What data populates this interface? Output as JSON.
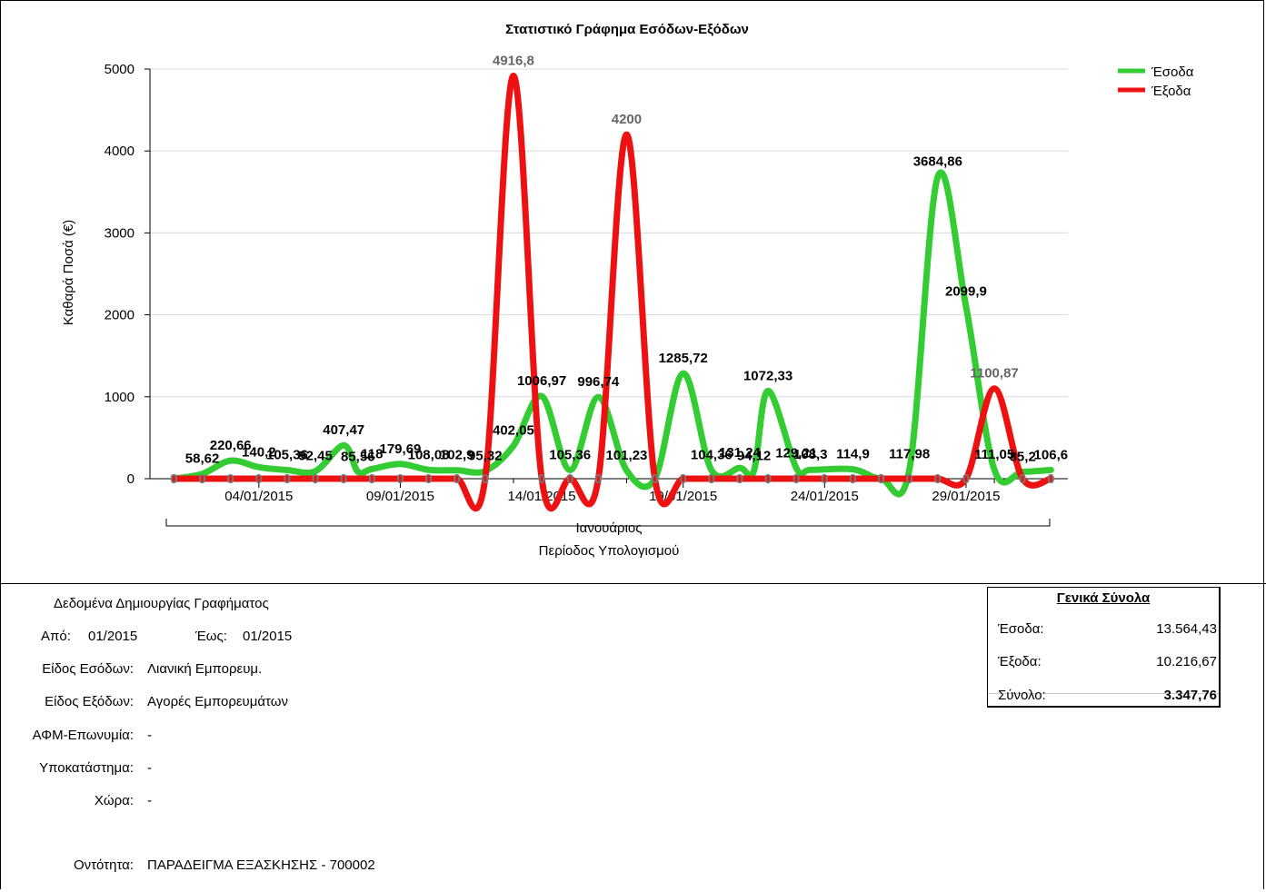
{
  "chart_data": {
    "type": "line",
    "title": "Στατιστικό Γράφημα Εσόδων-Εξόδων",
    "xlabel": "Περίοδος Υπολογισμού",
    "xgroup_label": "Ιανουάριος",
    "ylabel": "Καθαρά Ποσά (€)",
    "ylim": [
      0,
      5000
    ],
    "yticks": [
      "0",
      "1000",
      "2000",
      "3000",
      "4000",
      "5000"
    ],
    "xtick_labels": [
      {
        "day": 4,
        "label": "04/01/2015"
      },
      {
        "day": 9,
        "label": "09/01/2015"
      },
      {
        "day": 14,
        "label": "14/01/2015"
      },
      {
        "day": 19,
        "label": "19/01/2015"
      },
      {
        "day": 24,
        "label": "24/01/2015"
      },
      {
        "day": 29,
        "label": "29/01/2015"
      }
    ],
    "grid": true,
    "legend_position": "top-right",
    "series": [
      {
        "name": "Έσοδα",
        "color": "#33cc33",
        "points": [
          {
            "day": 1,
            "value": 0,
            "label": "0"
          },
          {
            "day": 2,
            "value": 58.62,
            "label": "58,62"
          },
          {
            "day": 3,
            "value": 220.66,
            "label": "220,66"
          },
          {
            "day": 4,
            "value": 140.2,
            "label": "140,2"
          },
          {
            "day": 5,
            "value": 105.36,
            "label": "105,36"
          },
          {
            "day": 6,
            "value": 92.45,
            "label": "92,45"
          },
          {
            "day": 7,
            "value": 407.47,
            "label": "407,47"
          },
          {
            "day": 7.5,
            "value": 85.56,
            "label": "85,56"
          },
          {
            "day": 8,
            "value": 118,
            "label": "118"
          },
          {
            "day": 9,
            "value": 179.69,
            "label": "179,69"
          },
          {
            "day": 10,
            "value": 108.08,
            "label": "108,08"
          },
          {
            "day": 11,
            "value": 102.9,
            "label": "102,9"
          },
          {
            "day": 12,
            "value": 95.32,
            "label": "95,32"
          },
          {
            "day": 13,
            "value": 402.05,
            "label": "402,05"
          },
          {
            "day": 14,
            "value": 1006.97,
            "label": "1006,97"
          },
          {
            "day": 15,
            "value": 105.36,
            "label": "105,36"
          },
          {
            "day": 16,
            "value": 996.74,
            "label": "996,74"
          },
          {
            "day": 17,
            "value": 101.23,
            "label": "101,23"
          },
          {
            "day": 18,
            "value": 0,
            "label": "0"
          },
          {
            "day": 19,
            "value": 1285.72,
            "label": "1285,72"
          },
          {
            "day": 20,
            "value": 104.36,
            "label": "104,36"
          },
          {
            "day": 21,
            "value": 131.24,
            "label": "131,24"
          },
          {
            "day": 21.5,
            "value": 94.12,
            "label": "94,12"
          },
          {
            "day": 22,
            "value": 1072.33,
            "label": "1072,33"
          },
          {
            "day": 23,
            "value": 129.21,
            "label": "129,21"
          },
          {
            "day": 23.5,
            "value": 108.3,
            "label": "108,3"
          },
          {
            "day": 25,
            "value": 114.9,
            "label": "114,9"
          },
          {
            "day": 26,
            "value": 0,
            "label": "0"
          },
          {
            "day": 27,
            "value": 117.98,
            "label": "117,98"
          },
          {
            "day": 28,
            "value": 3684.86,
            "label": "3684,86"
          },
          {
            "day": 29,
            "value": 2099.9,
            "label": "2099,9"
          },
          {
            "day": 30,
            "value": 111.05,
            "label": "111,05"
          },
          {
            "day": 31,
            "value": 85.2,
            "label": "85,2"
          },
          {
            "day": 32,
            "value": 106.6,
            "label": "106,6"
          }
        ]
      },
      {
        "name": "Έξοδα",
        "color": "#ee1111",
        "points": [
          {
            "day": 1,
            "value": 0,
            "label": "0"
          },
          {
            "day": 2,
            "value": 0,
            "label": "0"
          },
          {
            "day": 3,
            "value": 0,
            "label": "0"
          },
          {
            "day": 4,
            "value": 0,
            "label": "0"
          },
          {
            "day": 5,
            "value": 0,
            "label": "0"
          },
          {
            "day": 6,
            "value": 0,
            "label": "0"
          },
          {
            "day": 7,
            "value": 0,
            "label": "0"
          },
          {
            "day": 8,
            "value": 0,
            "label": "0"
          },
          {
            "day": 9,
            "value": 0,
            "label": "0"
          },
          {
            "day": 10,
            "value": 0,
            "label": "0"
          },
          {
            "day": 11,
            "value": 0,
            "label": "0"
          },
          {
            "day": 12,
            "value": 0,
            "label": "0"
          },
          {
            "day": 13,
            "value": 4916.8,
            "label": "4916,8"
          },
          {
            "day": 14,
            "value": 0,
            "label": "0"
          },
          {
            "day": 15,
            "value": 0,
            "label": "0"
          },
          {
            "day": 16,
            "value": 0,
            "label": "0"
          },
          {
            "day": 17,
            "value": 4200,
            "label": "4200"
          },
          {
            "day": 18,
            "value": 0,
            "label": "0"
          },
          {
            "day": 19,
            "value": 0,
            "label": "0"
          },
          {
            "day": 20,
            "value": 0,
            "label": "0"
          },
          {
            "day": 21,
            "value": 0,
            "label": "0"
          },
          {
            "day": 22,
            "value": 0,
            "label": "0"
          },
          {
            "day": 23,
            "value": 0,
            "label": "0"
          },
          {
            "day": 24,
            "value": 0,
            "label": "0"
          },
          {
            "day": 25,
            "value": 0,
            "label": "0"
          },
          {
            "day": 26,
            "value": 0,
            "label": "0"
          },
          {
            "day": 27,
            "value": 0,
            "label": "0"
          },
          {
            "day": 28,
            "value": 0,
            "label": "0"
          },
          {
            "day": 29,
            "value": 0,
            "label": "0"
          },
          {
            "day": 30,
            "value": 1100.87,
            "label": "1100,87"
          },
          {
            "day": 31,
            "value": 0,
            "label": "0"
          },
          {
            "day": 32,
            "value": 0,
            "label": "0"
          }
        ]
      }
    ]
  },
  "info": {
    "heading": "Δεδομένα Δημιουργίας Γραφήματος",
    "from_label": "Από:",
    "from_value": "01/2015",
    "to_label": "Έως:",
    "to_value": "01/2015",
    "income_type_label": "Είδος Εσόδων:",
    "income_type_value": "Λιανική Εμπορευμ.",
    "expense_type_label": "Είδος Εξόδων:",
    "expense_type_value": "Αγορές Εμπορευμάτων",
    "afm_label": "ΑΦΜ-Επωνυμία:",
    "afm_value": "-",
    "branch_label": "Υποκατάστημα:",
    "branch_value": "-",
    "country_label": "Χώρα:",
    "country_value": "-",
    "entity_label": "Οντότητα:",
    "entity_value": "ΠΑΡΑΔΕΙΓΜΑ ΕΞΑΣΚΗΣΗΣ - 700002"
  },
  "totals": {
    "title": "Γενικά Σύνολα",
    "income_label": "Έσοδα:",
    "income_value": "13.564,43",
    "expense_label": "Έξοδα:",
    "expense_value": "10.216,67",
    "total_label": "Σύνολο:",
    "total_value": "3.347,76"
  }
}
